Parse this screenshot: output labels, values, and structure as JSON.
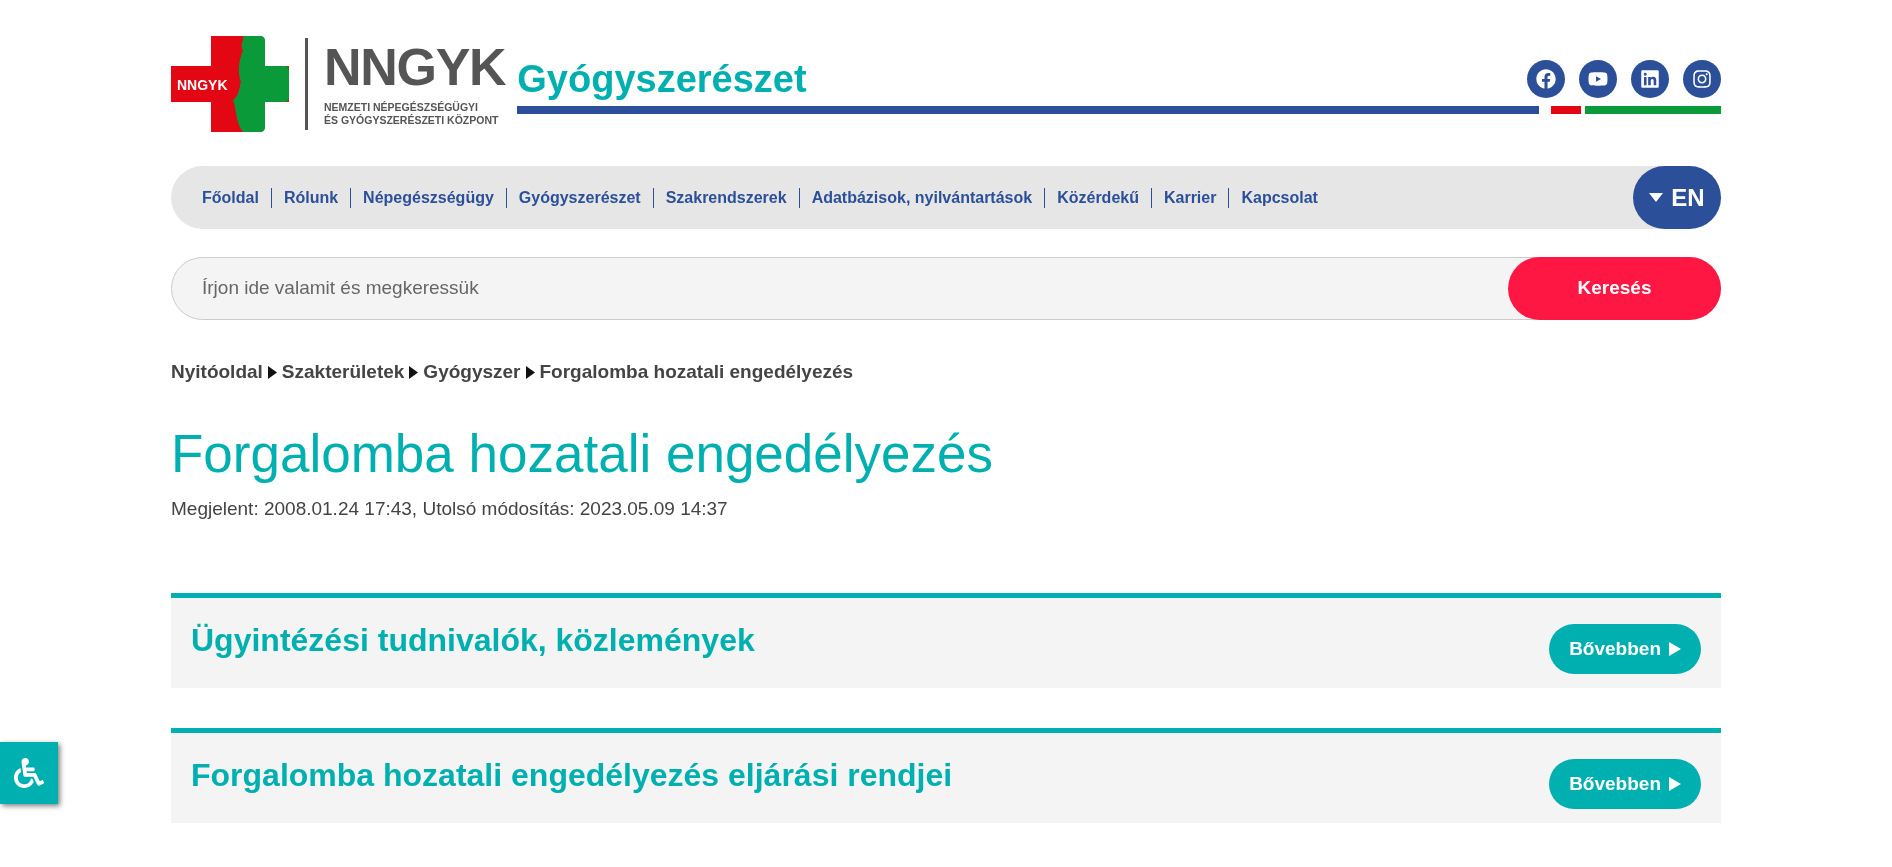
{
  "header": {
    "logo_badge": "NNGYK",
    "logo_title": "NNGYK",
    "logo_subtitle_1": "NEMZETI NÉPEGÉSZSÉGÜGYI",
    "logo_subtitle_2": "ÉS GYÓGYSZERÉSZETI KÖZPONT",
    "section_title": "Gyógyszerészet"
  },
  "social": [
    {
      "kind": "facebook"
    },
    {
      "kind": "youtube"
    },
    {
      "kind": "linkedin"
    },
    {
      "kind": "instagram"
    }
  ],
  "nav": {
    "items": [
      "Főoldal",
      "Rólunk",
      "Népegészségügy",
      "Gyógyszerészet",
      "Szakrendszerek",
      "Adatbázisok, nyilvántartások",
      "Közérdekű",
      "Karrier",
      "Kapcsolat"
    ],
    "language": "EN"
  },
  "search": {
    "placeholder": "Írjon ide valamit és megkeressük",
    "button": "Keresés"
  },
  "breadcrumb": [
    "Nyitóoldal",
    "Szakterületek",
    "Gyógyszer",
    "Forgalomba hozatali engedélyezés"
  ],
  "page": {
    "title": "Forgalomba hozatali engedélyezés",
    "meta": "Megjelent: 2008.01.24 17:43, Utolsó módosítás: 2023.05.09 14:37"
  },
  "cards": [
    {
      "title": "Ügyintézési tudnivalók, közlemények",
      "button": "Bővebben"
    },
    {
      "title": "Forgalomba hozatali engedélyezés eljárási rendjei",
      "button": "Bővebben"
    }
  ]
}
